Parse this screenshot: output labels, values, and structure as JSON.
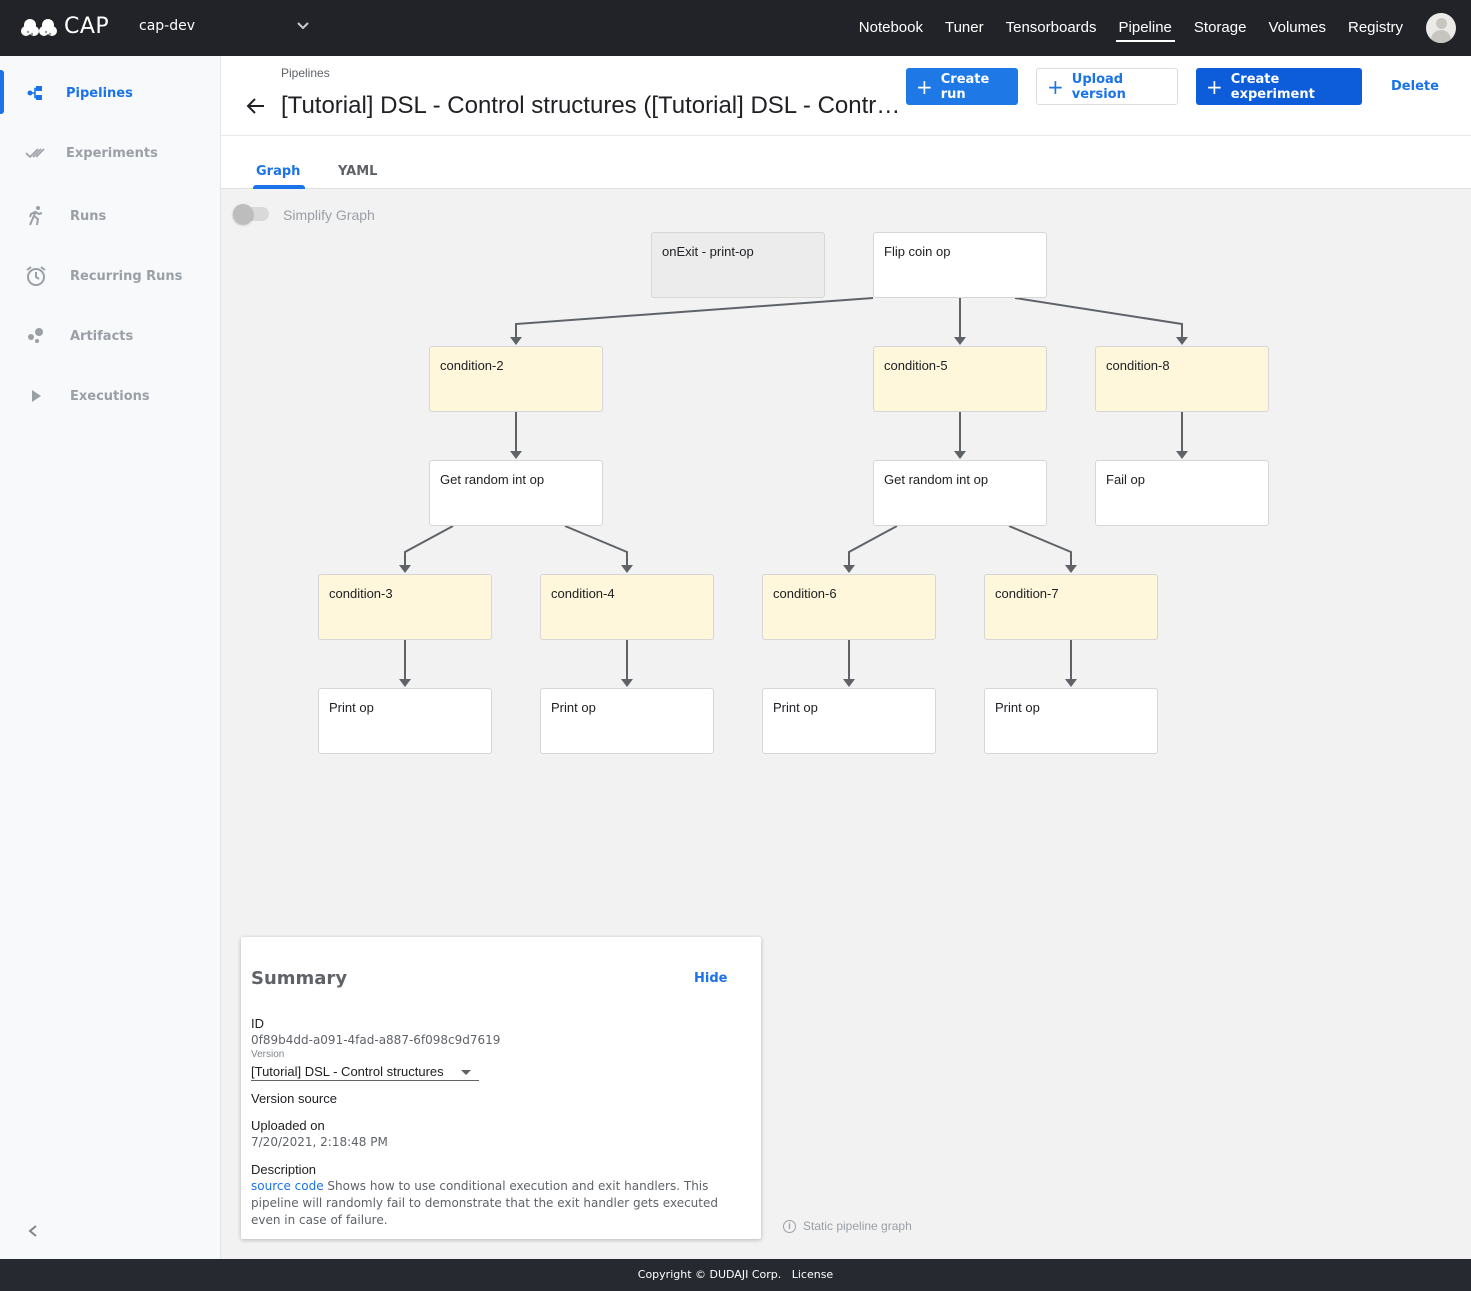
{
  "app": {
    "brand": "CAP",
    "namespace": "cap-dev"
  },
  "topnav": {
    "items": [
      {
        "label": "Notebook",
        "active": false
      },
      {
        "label": "Tuner",
        "active": false
      },
      {
        "label": "Tensorboards",
        "active": false
      },
      {
        "label": "Pipeline",
        "active": true
      },
      {
        "label": "Storage",
        "active": false
      },
      {
        "label": "Volumes",
        "active": false
      },
      {
        "label": "Registry",
        "active": false
      }
    ]
  },
  "sidebar": {
    "items": [
      {
        "label": "Pipelines",
        "icon": "pipelines-icon",
        "active": true
      },
      {
        "label": "Experiments",
        "icon": "experiments-icon",
        "active": false
      },
      {
        "label": "Runs",
        "icon": "runs-icon",
        "active": false
      },
      {
        "label": "Recurring Runs",
        "icon": "alarm-icon",
        "active": false
      },
      {
        "label": "Artifacts",
        "icon": "artifacts-icon",
        "active": false
      },
      {
        "label": "Executions",
        "icon": "play-icon",
        "active": false
      }
    ],
    "collapse_icon": "chevron-left-icon"
  },
  "header": {
    "breadcrumb": "Pipelines",
    "title": "[Tutorial] DSL - Control structures ([Tutorial] DSL - Control structures)",
    "buttons": {
      "create_run": "Create run",
      "upload_version": "Upload version",
      "create_experiment": "Create experiment",
      "delete": "Delete"
    }
  },
  "tabs": [
    {
      "label": "Graph",
      "active": true
    },
    {
      "label": "YAML",
      "active": false
    }
  ],
  "graph": {
    "simplify_label": "Simplify Graph",
    "simplify_on": false,
    "nodes": [
      {
        "id": "exit",
        "label": "onExit - print-op",
        "kind": "exit"
      },
      {
        "id": "flip",
        "label": "Flip coin op",
        "kind": "op"
      },
      {
        "id": "c2",
        "label": "condition-2",
        "kind": "condition"
      },
      {
        "id": "c5",
        "label": "condition-5",
        "kind": "condition"
      },
      {
        "id": "c8",
        "label": "condition-8",
        "kind": "condition"
      },
      {
        "id": "r1",
        "label": "Get random int op",
        "kind": "op"
      },
      {
        "id": "r2",
        "label": "Get random int op",
        "kind": "op"
      },
      {
        "id": "fail",
        "label": "Fail op",
        "kind": "op"
      },
      {
        "id": "c3",
        "label": "condition-3",
        "kind": "condition"
      },
      {
        "id": "c4",
        "label": "condition-4",
        "kind": "condition"
      },
      {
        "id": "c6",
        "label": "condition-6",
        "kind": "condition"
      },
      {
        "id": "c7",
        "label": "condition-7",
        "kind": "condition"
      },
      {
        "id": "p3",
        "label": "Print op",
        "kind": "op"
      },
      {
        "id": "p4",
        "label": "Print op",
        "kind": "op"
      },
      {
        "id": "p6",
        "label": "Print op",
        "kind": "op"
      },
      {
        "id": "p7",
        "label": "Print op",
        "kind": "op"
      }
    ],
    "edges": [
      [
        "flip",
        "c2"
      ],
      [
        "flip",
        "c5"
      ],
      [
        "flip",
        "c8"
      ],
      [
        "c2",
        "r1"
      ],
      [
        "c5",
        "r2"
      ],
      [
        "c8",
        "fail"
      ],
      [
        "r1",
        "c3"
      ],
      [
        "r1",
        "c4"
      ],
      [
        "r2",
        "c6"
      ],
      [
        "r2",
        "c7"
      ],
      [
        "c3",
        "p3"
      ],
      [
        "c4",
        "p4"
      ],
      [
        "c6",
        "p6"
      ],
      [
        "c7",
        "p7"
      ]
    ],
    "static_note": "Static pipeline graph"
  },
  "summary": {
    "title": "Summary",
    "hide_label": "Hide",
    "id_label": "ID",
    "id_value": "0f89b4dd-a091-4fad-a887-6f098c9d7619",
    "version_label": "Version",
    "version_value": "[Tutorial] DSL - Control structures",
    "version_source_label": "Version source",
    "uploaded_label": "Uploaded on",
    "uploaded_value": "7/20/2021, 2:18:48 PM",
    "description_label": "Description",
    "description_link": "source code",
    "description_text": " Shows how to use conditional execution and exit handlers. This pipeline will randomly fail to demonstrate that the exit handler gets executed even in case of failure."
  },
  "footer": {
    "copyright": "Copyright © DUDAJI Corp.",
    "license": "License"
  },
  "colors": {
    "accent": "#1a73e8",
    "topbar": "#212328",
    "condition_fill": "#fef7dc",
    "exit_fill": "#ececec"
  }
}
